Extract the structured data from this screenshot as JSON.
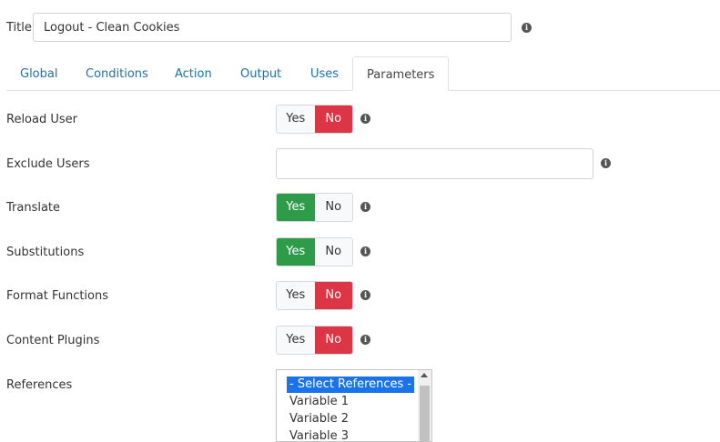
{
  "title_field": {
    "label": "Title",
    "value": "Logout - Clean Cookies"
  },
  "tabs": [
    {
      "label": "Global",
      "active": false
    },
    {
      "label": "Conditions",
      "active": false
    },
    {
      "label": "Action",
      "active": false
    },
    {
      "label": "Output",
      "active": false
    },
    {
      "label": "Uses",
      "active": false
    },
    {
      "label": "Parameters",
      "active": true
    }
  ],
  "fields": {
    "reload_user": {
      "label": "Reload User",
      "yes": "Yes",
      "no": "No",
      "selected": "No"
    },
    "exclude_users": {
      "label": "Exclude Users",
      "value": ""
    },
    "translate": {
      "label": "Translate",
      "yes": "Yes",
      "no": "No",
      "selected": "Yes"
    },
    "substitutions": {
      "label": "Substitutions",
      "yes": "Yes",
      "no": "No",
      "selected": "Yes"
    },
    "format_functions": {
      "label": "Format Functions",
      "yes": "Yes",
      "no": "No",
      "selected": "No"
    },
    "content_plugins": {
      "label": "Content Plugins",
      "yes": "Yes",
      "no": "No",
      "selected": "No"
    },
    "references": {
      "label": "References",
      "options": [
        "- Select References -",
        "Variable 1",
        "Variable 2",
        "Variable 3"
      ],
      "selected": "- Select References -"
    }
  },
  "info_icon": "i",
  "colors": {
    "yes_active": "#2d9b48",
    "no_active": "#dc3545",
    "tab_link": "#1a73a8",
    "list_selected": "#1a73e8"
  }
}
